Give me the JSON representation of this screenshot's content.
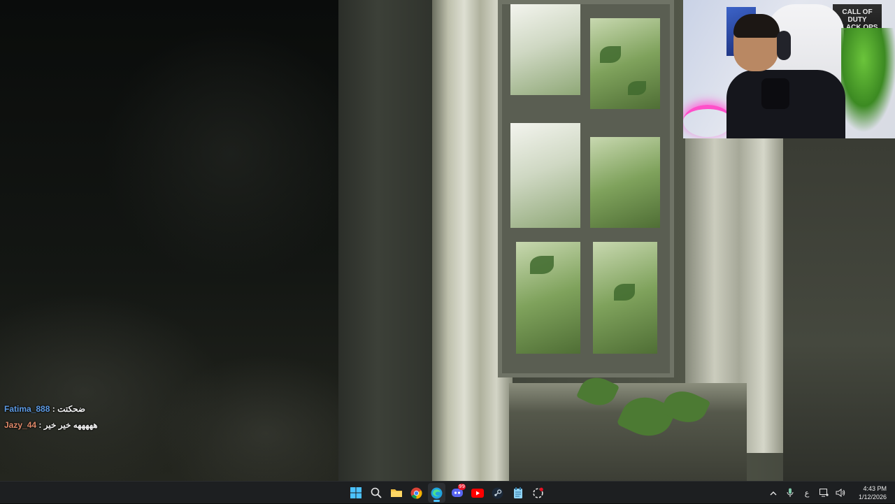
{
  "chat": {
    "messages": [
      {
        "user": "Fatima_888",
        "separator": ":",
        "text": "ضحكتت"
      },
      {
        "user": "Jazy_44",
        "separator": ":",
        "text": "هههههه خير خير"
      }
    ]
  },
  "webcam": {
    "poster_text": "CALL OF DUTY BLACK OPS II"
  },
  "taskbar": {
    "apps": [
      {
        "name": "Start",
        "icon": "windows-start-icon"
      },
      {
        "name": "Search",
        "icon": "search-icon"
      },
      {
        "name": "File Explorer",
        "icon": "folder-icon"
      },
      {
        "name": "Google Chrome",
        "icon": "chrome-icon"
      },
      {
        "name": "Microsoft Edge",
        "icon": "edge-icon",
        "active": true
      },
      {
        "name": "Discord",
        "icon": "discord-icon",
        "badge": "99"
      },
      {
        "name": "YouTube",
        "icon": "youtube-icon"
      },
      {
        "name": "Steam",
        "icon": "steam-icon"
      },
      {
        "name": "Notepad",
        "icon": "notepad-icon"
      },
      {
        "name": "Snipping Tool",
        "icon": "snipping-tool-icon"
      }
    ],
    "tray": {
      "language": "ع",
      "time": "4:43 PM",
      "date": "1/12/2026"
    }
  },
  "colors": {
    "taskbar_bg": "#1d1f21",
    "accent": "#4cc2ff",
    "chat_user_1": "#5e9ce6",
    "chat_user_2": "#e08a6a"
  }
}
